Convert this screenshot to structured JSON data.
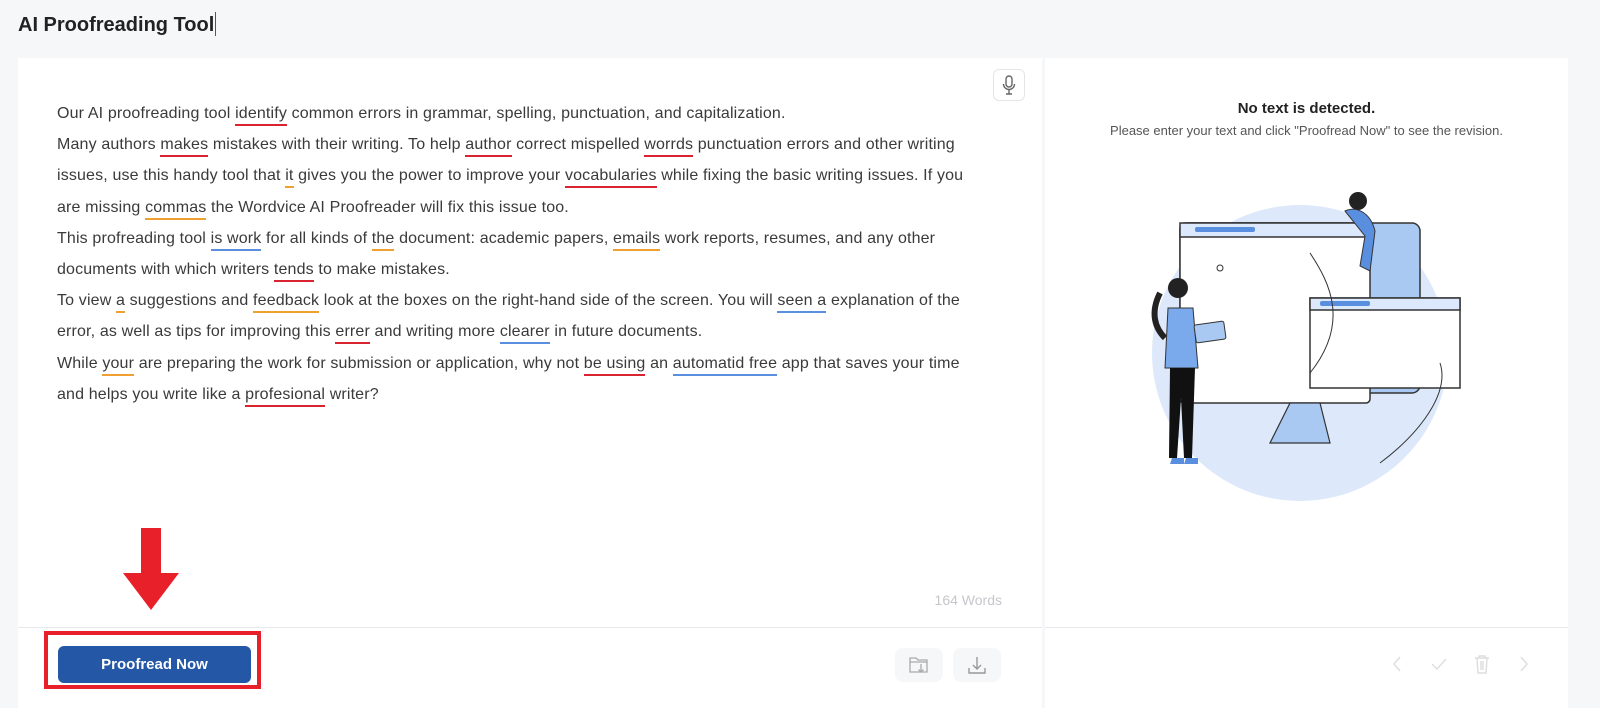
{
  "header": {
    "title": "AI Proofreading Tool"
  },
  "editor": {
    "paragraphs": [
      [
        [
          "Our AI proofreading tool ",
          ""
        ],
        [
          "identify",
          "red"
        ],
        [
          " common errors in grammar, spelling, punctuation, and capitalization.",
          ""
        ]
      ],
      [
        [
          "Many authors ",
          ""
        ],
        [
          "makes",
          "red"
        ],
        [
          " mistakes with their writing. To help ",
          ""
        ],
        [
          "author",
          "red"
        ],
        [
          " correct mispelled ",
          ""
        ],
        [
          "worrds",
          "red"
        ],
        [
          " punctuation errors and other writing issues, use this handy tool that ",
          ""
        ],
        [
          "it",
          "orange"
        ],
        [
          " gives you the power to improve your ",
          ""
        ],
        [
          "vocabularies",
          "red"
        ],
        [
          " while fixing the basic writing issues. If you are missing ",
          ""
        ],
        [
          "commas",
          "orange"
        ],
        [
          " the Wordvice AI Proofreader will fix this issue too.",
          ""
        ]
      ],
      [
        [
          "This profreading tool ",
          ""
        ],
        [
          "is work",
          "blue"
        ],
        [
          " for all kinds of ",
          ""
        ],
        [
          "the",
          "orange"
        ],
        [
          " document: academic papers, ",
          ""
        ],
        [
          "emails",
          "orange"
        ],
        [
          " work reports, resumes, and any other documents with which writers ",
          ""
        ],
        [
          "tends",
          "red"
        ],
        [
          " to make mistakes.",
          ""
        ]
      ],
      [
        [
          "To view ",
          ""
        ],
        [
          "a",
          "orange"
        ],
        [
          " suggestions and ",
          ""
        ],
        [
          "feedback",
          "orange"
        ],
        [
          " look at the boxes on the right-hand side of the screen. You will ",
          ""
        ],
        [
          "seen a",
          "blue"
        ],
        [
          " explanation of the error, as well as tips for improving this ",
          ""
        ],
        [
          "errer",
          "red"
        ],
        [
          " and writing more ",
          ""
        ],
        [
          "clearer",
          "blue"
        ],
        [
          " in future documents.",
          ""
        ]
      ],
      [
        [
          "While ",
          ""
        ],
        [
          "your",
          "orange"
        ],
        [
          " are preparing the work for submission or application, why not ",
          ""
        ],
        [
          "be using",
          "red"
        ],
        [
          " an ",
          ""
        ],
        [
          "automatid free",
          "blue"
        ],
        [
          " app that saves your time and helps you write like a ",
          ""
        ],
        [
          "profesional",
          "red"
        ],
        [
          " writer?",
          ""
        ]
      ]
    ],
    "word_count": "164 Words",
    "mic_icon": "microphone-icon"
  },
  "actions": {
    "proofread_label": "Proofread Now",
    "save_icon": "folder-download-icon",
    "download_icon": "download-icon"
  },
  "result": {
    "empty_title": "No text is detected.",
    "empty_message": "Please enter your text and click \"Proofread Now\" to see the revision.",
    "nav_icons": [
      "chevron-left-icon",
      "check-icon",
      "trash-icon",
      "chevron-right-icon"
    ]
  },
  "colors": {
    "accent": "#2557a7",
    "error_red": "#d9232e",
    "warning_orange": "#f0a030",
    "style_blue": "#5a8fe0",
    "highlight": "#e8202a"
  }
}
